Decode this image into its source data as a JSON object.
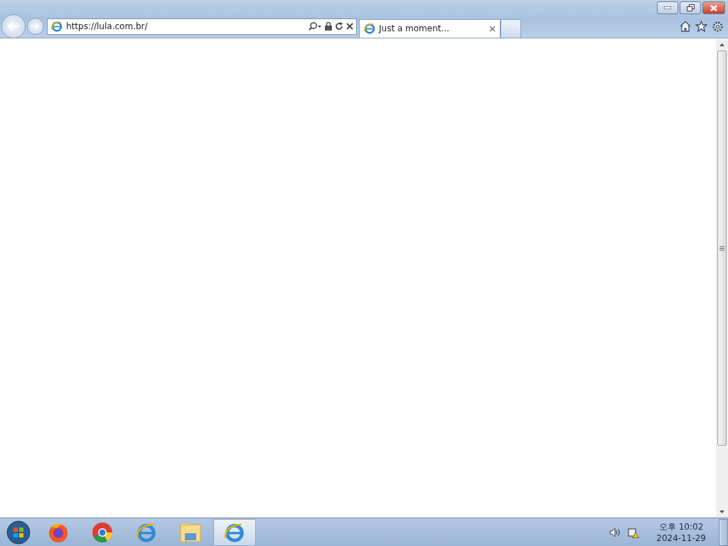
{
  "address_bar": {
    "url": "https://lula.com.br/"
  },
  "tabs": [
    {
      "title": "Just a moment...",
      "selected": true
    }
  ],
  "taskbar": {
    "apps": [
      {
        "kind": "firefox",
        "selected": false
      },
      {
        "kind": "chrome",
        "selected": false
      },
      {
        "kind": "ie",
        "selected": false
      },
      {
        "kind": "explorer",
        "selected": false
      },
      {
        "kind": "ie",
        "selected": true
      }
    ],
    "clock": {
      "time": "오후 10:02",
      "date": "2024-11-29"
    }
  }
}
